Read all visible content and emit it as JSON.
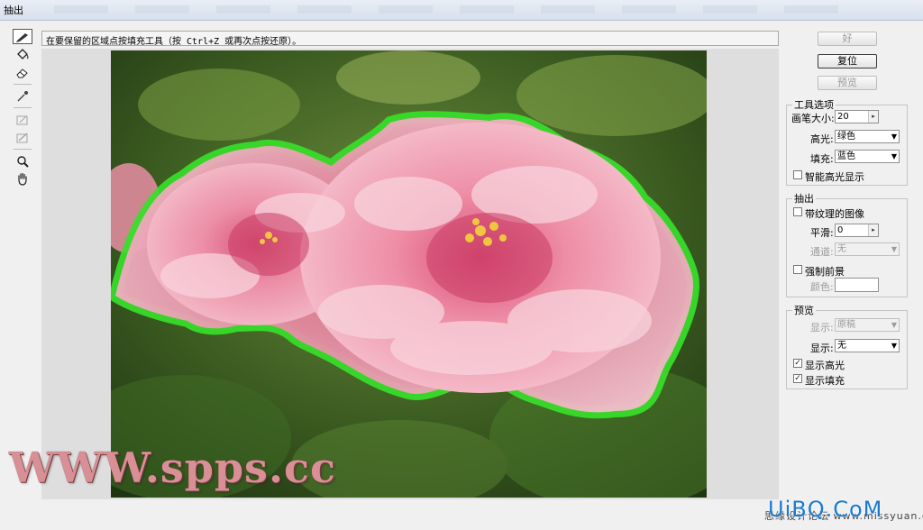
{
  "window": {
    "title": "抽出"
  },
  "hint": "在要保留的区域点按填充工具（按 Ctrl+Z 或再次点按还原）。",
  "tools": [
    {
      "name": "edge-highlighter-tool",
      "icon": "pencil-icon",
      "active": true
    },
    {
      "name": "fill-tool",
      "icon": "paint-bucket-icon"
    },
    {
      "name": "eraser-tool",
      "icon": "eraser-icon"
    },
    {
      "name": "eyedropper-tool",
      "icon": "eyedropper-icon"
    },
    {
      "name": "cleanup-tool",
      "icon": "cleanup-icon",
      "disabled": true
    },
    {
      "name": "edge-touchup-tool",
      "icon": "touchup-icon",
      "disabled": true
    },
    {
      "name": "zoom-tool",
      "icon": "magnifier-icon"
    },
    {
      "name": "hand-tool",
      "icon": "hand-icon"
    }
  ],
  "buttons": {
    "ok": "好",
    "reset": "复位",
    "preview": "预览"
  },
  "tool_options": {
    "legend": "工具选项",
    "brush_size_label": "画笔大小:",
    "brush_size": "20",
    "highlight_label": "高光:",
    "highlight_value": "绿色",
    "fill_label": "填充:",
    "fill_value": "蓝色",
    "smart_highlight_label": "智能高光显示",
    "smart_highlight_checked": false
  },
  "extraction": {
    "legend": "抽出",
    "textured_label": "带纹理的图像",
    "textured_checked": false,
    "smooth_label": "平滑:",
    "smooth_value": "0",
    "channel_label": "通道:",
    "channel_value": "无",
    "force_fg_label": "强制前景",
    "force_fg_checked": false,
    "color_label": "颜色:"
  },
  "preview_group": {
    "legend": "预览",
    "show_label_1": "显示:",
    "show_value_1": "原稿",
    "show_label_2": "显示:",
    "show_value_2": "无",
    "show_highlight_label": "显示高光",
    "show_highlight_checked": true,
    "show_fill_label": "显示填充",
    "show_fill_checked": true
  },
  "overlays": {
    "watermark": "WWW.spps.cc",
    "logo": "UiBQ.CoM",
    "footer_text": "思缘设计论坛 www.missyuan.com"
  },
  "colors": {
    "highlight": "#37e02a",
    "accent": "#1a7bd1"
  }
}
